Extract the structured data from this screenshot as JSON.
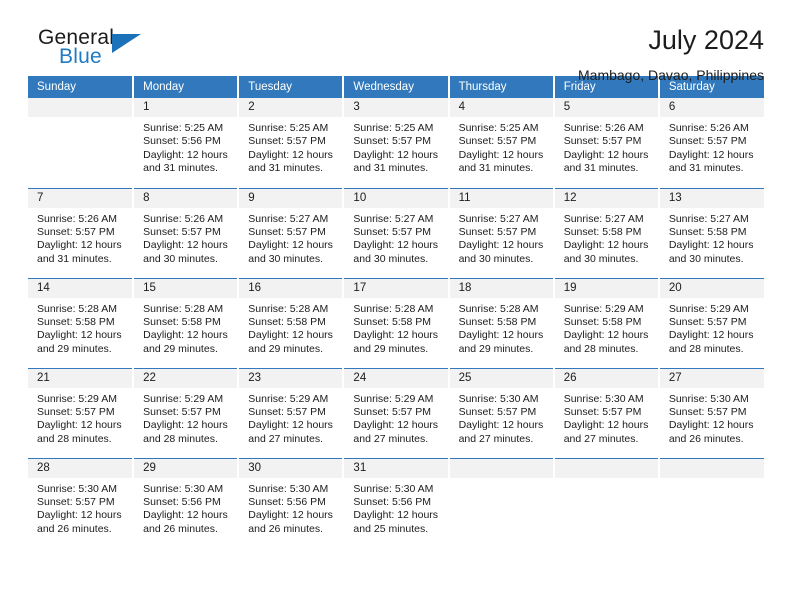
{
  "brand": {
    "name_top": "General",
    "name_bottom": "Blue",
    "accent_color": "#1b72b8"
  },
  "header": {
    "title": "July 2024",
    "subtitle": "Mambago, Davao, Philippines"
  },
  "calendar": {
    "header_bg": "#3179bc",
    "daynum_bg": "#f2f2f2",
    "weekday_headers": [
      "Sunday",
      "Monday",
      "Tuesday",
      "Wednesday",
      "Thursday",
      "Friday",
      "Saturday"
    ],
    "labels": {
      "sunrise": "Sunrise:",
      "sunset": "Sunset:",
      "daylight": "Daylight:"
    },
    "weeks": [
      [
        {
          "day": "",
          "empty": true
        },
        {
          "day": "1",
          "sunrise": "Sunrise: 5:25 AM",
          "sunset": "Sunset: 5:56 PM",
          "daylight_1": "Daylight: 12 hours",
          "daylight_2": "and 31 minutes."
        },
        {
          "day": "2",
          "sunrise": "Sunrise: 5:25 AM",
          "sunset": "Sunset: 5:57 PM",
          "daylight_1": "Daylight: 12 hours",
          "daylight_2": "and 31 minutes."
        },
        {
          "day": "3",
          "sunrise": "Sunrise: 5:25 AM",
          "sunset": "Sunset: 5:57 PM",
          "daylight_1": "Daylight: 12 hours",
          "daylight_2": "and 31 minutes."
        },
        {
          "day": "4",
          "sunrise": "Sunrise: 5:25 AM",
          "sunset": "Sunset: 5:57 PM",
          "daylight_1": "Daylight: 12 hours",
          "daylight_2": "and 31 minutes."
        },
        {
          "day": "5",
          "sunrise": "Sunrise: 5:26 AM",
          "sunset": "Sunset: 5:57 PM",
          "daylight_1": "Daylight: 12 hours",
          "daylight_2": "and 31 minutes."
        },
        {
          "day": "6",
          "sunrise": "Sunrise: 5:26 AM",
          "sunset": "Sunset: 5:57 PM",
          "daylight_1": "Daylight: 12 hours",
          "daylight_2": "and 31 minutes."
        }
      ],
      [
        {
          "day": "7",
          "sunrise": "Sunrise: 5:26 AM",
          "sunset": "Sunset: 5:57 PM",
          "daylight_1": "Daylight: 12 hours",
          "daylight_2": "and 31 minutes."
        },
        {
          "day": "8",
          "sunrise": "Sunrise: 5:26 AM",
          "sunset": "Sunset: 5:57 PM",
          "daylight_1": "Daylight: 12 hours",
          "daylight_2": "and 30 minutes."
        },
        {
          "day": "9",
          "sunrise": "Sunrise: 5:27 AM",
          "sunset": "Sunset: 5:57 PM",
          "daylight_1": "Daylight: 12 hours",
          "daylight_2": "and 30 minutes."
        },
        {
          "day": "10",
          "sunrise": "Sunrise: 5:27 AM",
          "sunset": "Sunset: 5:57 PM",
          "daylight_1": "Daylight: 12 hours",
          "daylight_2": "and 30 minutes."
        },
        {
          "day": "11",
          "sunrise": "Sunrise: 5:27 AM",
          "sunset": "Sunset: 5:57 PM",
          "daylight_1": "Daylight: 12 hours",
          "daylight_2": "and 30 minutes."
        },
        {
          "day": "12",
          "sunrise": "Sunrise: 5:27 AM",
          "sunset": "Sunset: 5:58 PM",
          "daylight_1": "Daylight: 12 hours",
          "daylight_2": "and 30 minutes."
        },
        {
          "day": "13",
          "sunrise": "Sunrise: 5:27 AM",
          "sunset": "Sunset: 5:58 PM",
          "daylight_1": "Daylight: 12 hours",
          "daylight_2": "and 30 minutes."
        }
      ],
      [
        {
          "day": "14",
          "sunrise": "Sunrise: 5:28 AM",
          "sunset": "Sunset: 5:58 PM",
          "daylight_1": "Daylight: 12 hours",
          "daylight_2": "and 29 minutes."
        },
        {
          "day": "15",
          "sunrise": "Sunrise: 5:28 AM",
          "sunset": "Sunset: 5:58 PM",
          "daylight_1": "Daylight: 12 hours",
          "daylight_2": "and 29 minutes."
        },
        {
          "day": "16",
          "sunrise": "Sunrise: 5:28 AM",
          "sunset": "Sunset: 5:58 PM",
          "daylight_1": "Daylight: 12 hours",
          "daylight_2": "and 29 minutes."
        },
        {
          "day": "17",
          "sunrise": "Sunrise: 5:28 AM",
          "sunset": "Sunset: 5:58 PM",
          "daylight_1": "Daylight: 12 hours",
          "daylight_2": "and 29 minutes."
        },
        {
          "day": "18",
          "sunrise": "Sunrise: 5:28 AM",
          "sunset": "Sunset: 5:58 PM",
          "daylight_1": "Daylight: 12 hours",
          "daylight_2": "and 29 minutes."
        },
        {
          "day": "19",
          "sunrise": "Sunrise: 5:29 AM",
          "sunset": "Sunset: 5:58 PM",
          "daylight_1": "Daylight: 12 hours",
          "daylight_2": "and 28 minutes."
        },
        {
          "day": "20",
          "sunrise": "Sunrise: 5:29 AM",
          "sunset": "Sunset: 5:57 PM",
          "daylight_1": "Daylight: 12 hours",
          "daylight_2": "and 28 minutes."
        }
      ],
      [
        {
          "day": "21",
          "sunrise": "Sunrise: 5:29 AM",
          "sunset": "Sunset: 5:57 PM",
          "daylight_1": "Daylight: 12 hours",
          "daylight_2": "and 28 minutes."
        },
        {
          "day": "22",
          "sunrise": "Sunrise: 5:29 AM",
          "sunset": "Sunset: 5:57 PM",
          "daylight_1": "Daylight: 12 hours",
          "daylight_2": "and 28 minutes."
        },
        {
          "day": "23",
          "sunrise": "Sunrise: 5:29 AM",
          "sunset": "Sunset: 5:57 PM",
          "daylight_1": "Daylight: 12 hours",
          "daylight_2": "and 27 minutes."
        },
        {
          "day": "24",
          "sunrise": "Sunrise: 5:29 AM",
          "sunset": "Sunset: 5:57 PM",
          "daylight_1": "Daylight: 12 hours",
          "daylight_2": "and 27 minutes."
        },
        {
          "day": "25",
          "sunrise": "Sunrise: 5:30 AM",
          "sunset": "Sunset: 5:57 PM",
          "daylight_1": "Daylight: 12 hours",
          "daylight_2": "and 27 minutes."
        },
        {
          "day": "26",
          "sunrise": "Sunrise: 5:30 AM",
          "sunset": "Sunset: 5:57 PM",
          "daylight_1": "Daylight: 12 hours",
          "daylight_2": "and 27 minutes."
        },
        {
          "day": "27",
          "sunrise": "Sunrise: 5:30 AM",
          "sunset": "Sunset: 5:57 PM",
          "daylight_1": "Daylight: 12 hours",
          "daylight_2": "and 26 minutes."
        }
      ],
      [
        {
          "day": "28",
          "sunrise": "Sunrise: 5:30 AM",
          "sunset": "Sunset: 5:57 PM",
          "daylight_1": "Daylight: 12 hours",
          "daylight_2": "and 26 minutes."
        },
        {
          "day": "29",
          "sunrise": "Sunrise: 5:30 AM",
          "sunset": "Sunset: 5:56 PM",
          "daylight_1": "Daylight: 12 hours",
          "daylight_2": "and 26 minutes."
        },
        {
          "day": "30",
          "sunrise": "Sunrise: 5:30 AM",
          "sunset": "Sunset: 5:56 PM",
          "daylight_1": "Daylight: 12 hours",
          "daylight_2": "and 26 minutes."
        },
        {
          "day": "31",
          "sunrise": "Sunrise: 5:30 AM",
          "sunset": "Sunset: 5:56 PM",
          "daylight_1": "Daylight: 12 hours",
          "daylight_2": "and 25 minutes."
        },
        {
          "day": "",
          "empty": true
        },
        {
          "day": "",
          "empty": true
        },
        {
          "day": "",
          "empty": true
        }
      ]
    ]
  }
}
